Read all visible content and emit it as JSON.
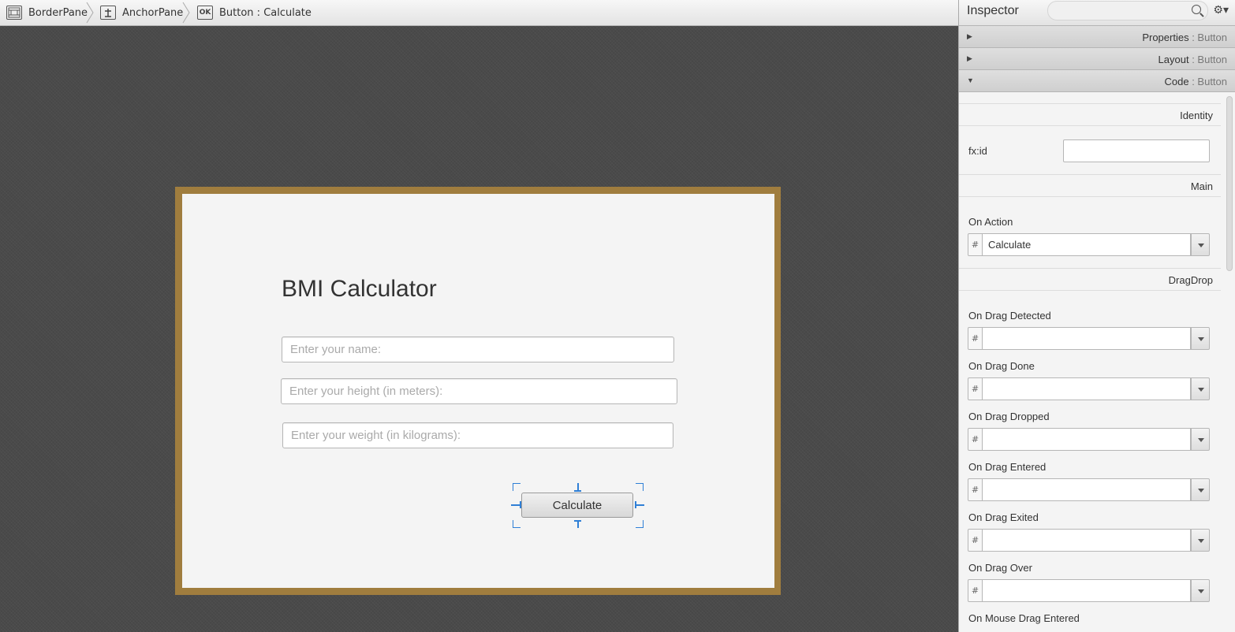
{
  "breadcrumb": {
    "items": [
      {
        "label": "BorderPane",
        "icon": "borderpane-icon"
      },
      {
        "label": "AnchorPane",
        "icon": "anchorpane-icon"
      },
      {
        "label": "Button : Calculate",
        "icon": "button-icon",
        "icon_text": "OK"
      }
    ]
  },
  "canvas": {
    "title": "BMI Calculator",
    "fields": [
      {
        "placeholder": "Enter your name:"
      },
      {
        "placeholder": "Enter your height (in meters):"
      },
      {
        "placeholder": "Enter your weight (in kilograms):"
      }
    ],
    "button_label": "Calculate",
    "frame_color": "#a07d3e"
  },
  "inspector": {
    "title": "Inspector",
    "sections": [
      {
        "label": "Properties",
        "sub": " : Button",
        "expanded": false
      },
      {
        "label": "Layout",
        "sub": " : Button",
        "expanded": false
      },
      {
        "label": "Code",
        "sub": " : Button",
        "expanded": true
      }
    ],
    "groups": {
      "identity": "Identity",
      "main": "Main",
      "dragdrop": "DragDrop"
    },
    "fxid_label": "fx:id",
    "on_action": {
      "label": "On Action",
      "value": "Calculate"
    },
    "events": [
      {
        "label": "On Drag Detected",
        "value": ""
      },
      {
        "label": "On Drag Done",
        "value": ""
      },
      {
        "label": "On Drag Dropped",
        "value": ""
      },
      {
        "label": "On Drag Entered",
        "value": ""
      },
      {
        "label": "On Drag Exited",
        "value": ""
      },
      {
        "label": "On Drag Over",
        "value": ""
      },
      {
        "label": "On Mouse Drag Entered",
        "value": ""
      }
    ],
    "hash": "#"
  }
}
